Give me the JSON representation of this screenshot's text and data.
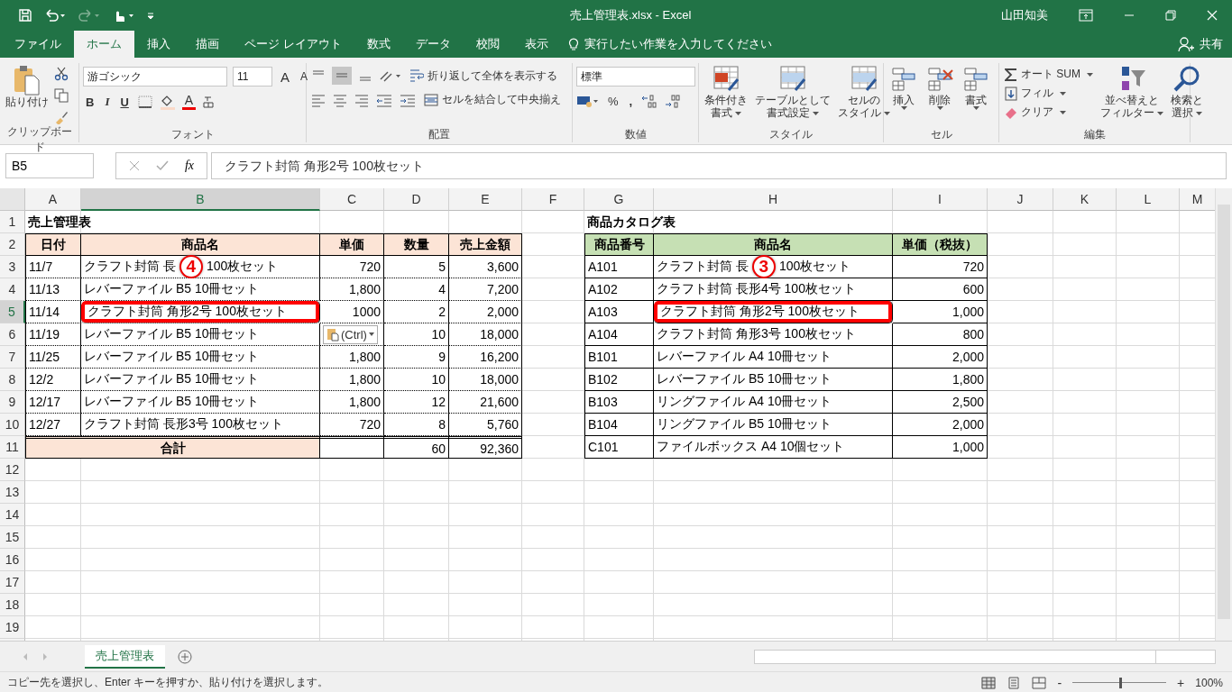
{
  "window": {
    "title": "売上管理表.xlsx  -  Excel",
    "user": "山田知美"
  },
  "tabs": [
    {
      "label": "ファイル",
      "selected": false
    },
    {
      "label": "ホーム",
      "selected": true
    },
    {
      "label": "挿入",
      "selected": false
    },
    {
      "label": "描画",
      "selected": false
    },
    {
      "label": "ページ レイアウト",
      "selected": false
    },
    {
      "label": "数式",
      "selected": false
    },
    {
      "label": "データ",
      "selected": false
    },
    {
      "label": "校閲",
      "selected": false
    },
    {
      "label": "表示",
      "selected": false
    }
  ],
  "tell_me": "実行したい作業を入力してください",
  "share": "共有",
  "ribbon": {
    "clipboard": {
      "label": "クリップボード",
      "paste": "貼り付け"
    },
    "font": {
      "label": "フォント",
      "family": "游ゴシック",
      "size": "11",
      "grow": "A",
      "shrink": "A",
      "bold": "B",
      "italic": "I",
      "underline": "U",
      "font_color": "A"
    },
    "alignment": {
      "label": "配置",
      "wrap": "折り返して全体を表示する",
      "merge": "セルを結合して中央揃え"
    },
    "number": {
      "label": "数値",
      "format": "標準",
      "percent": "%",
      "comma": ","
    },
    "styles": {
      "label": "スタイル",
      "buttons": [
        [
          "条件付き",
          "書式"
        ],
        [
          "テーブルとして",
          "書式設定"
        ],
        [
          "セルの",
          "スタイル"
        ]
      ]
    },
    "cells": {
      "label": "セル",
      "buttons": [
        "挿入",
        "削除",
        "書式"
      ]
    },
    "editing": {
      "label": "編集",
      "autosum": "オート SUM",
      "fill": "フィル",
      "clear": "クリア",
      "buttons": [
        [
          "並べ替えと",
          "フィルター"
        ],
        [
          "検索と",
          "選択"
        ]
      ]
    }
  },
  "formula_bar": {
    "name_box": "B5",
    "fx": "fx",
    "content": "クラフト封筒 角形2号 100枚セット"
  },
  "sheet": {
    "columns": [
      {
        "label": "A",
        "selected": false
      },
      {
        "label": "B",
        "selected": true
      },
      {
        "label": "C",
        "selected": false
      },
      {
        "label": "D",
        "selected": false
      },
      {
        "label": "E",
        "selected": false
      },
      {
        "label": "F",
        "selected": false
      },
      {
        "label": "G",
        "selected": false
      },
      {
        "label": "H",
        "selected": false
      },
      {
        "label": "I",
        "selected": false
      },
      {
        "label": "J",
        "selected": false
      },
      {
        "label": "K",
        "selected": false
      },
      {
        "label": "L",
        "selected": false
      },
      {
        "label": "M",
        "selected": false
      }
    ],
    "rows": [
      {
        "label": "1",
        "selected": false
      },
      {
        "label": "2",
        "selected": false
      },
      {
        "label": "3",
        "selected": false
      },
      {
        "label": "4",
        "selected": false
      },
      {
        "label": "5",
        "selected": true
      },
      {
        "label": "6",
        "selected": false
      },
      {
        "label": "7",
        "selected": false
      },
      {
        "label": "8",
        "selected": false
      },
      {
        "label": "9",
        "selected": false
      },
      {
        "label": "10",
        "selected": false
      },
      {
        "label": "11",
        "selected": false
      },
      {
        "label": "12",
        "selected": false
      },
      {
        "label": "13",
        "selected": false
      },
      {
        "label": "14",
        "selected": false
      },
      {
        "label": "15",
        "selected": false
      },
      {
        "label": "16",
        "selected": false
      },
      {
        "label": "17",
        "selected": false
      },
      {
        "label": "18",
        "selected": false
      },
      {
        "label": "19",
        "selected": false
      }
    ]
  },
  "sales": {
    "title": "売上管理表",
    "headers": [
      "日付",
      "商品名",
      "単価",
      "数量",
      "売上金額"
    ],
    "rows": [
      {
        "date": "11/7",
        "name_before": "クラフト封筒 長",
        "marker": "4",
        "name_after": "100枚セット",
        "price": "720",
        "qty": "5",
        "amount": "3,600",
        "highlighted": false
      },
      {
        "date": "11/13",
        "name": "レバーファイル B5 10冊セット",
        "price": "1,800",
        "qty": "4",
        "amount": "7,200",
        "highlighted": false
      },
      {
        "date": "11/14",
        "name": "クラフト封筒 角形2号 100枚セット",
        "price": "1000",
        "qty": "2",
        "amount": "2,000",
        "highlighted": true
      },
      {
        "date": "11/19",
        "name": "レバーファイル B5 10冊セット",
        "paste_button": "(Ctrl)",
        "qty": "10",
        "amount": "18,000",
        "highlighted": false
      },
      {
        "date": "11/25",
        "name": "レバーファイル B5 10冊セット",
        "price": "1,800",
        "qty": "9",
        "amount": "16,200",
        "highlighted": false
      },
      {
        "date": "12/2",
        "name": "レバーファイル B5 10冊セット",
        "price": "1,800",
        "qty": "10",
        "amount": "18,000",
        "highlighted": false
      },
      {
        "date": "12/17",
        "name": "レバーファイル B5 10冊セット",
        "price": "1,800",
        "qty": "12",
        "amount": "21,600",
        "highlighted": false
      },
      {
        "date": "12/27",
        "name": "クラフト封筒 長形3号 100枚セット",
        "price": "720",
        "qty": "8",
        "amount": "5,760",
        "highlighted": false
      }
    ],
    "total": {
      "label": "合計",
      "qty": "60",
      "amount": "92,360"
    }
  },
  "catalog": {
    "title": "商品カタログ表",
    "headers": [
      "商品番号",
      "商品名",
      "単価（税抜）"
    ],
    "rows": [
      {
        "code": "A101",
        "name_before": "クラフト封筒 長",
        "marker": "3",
        "name_after": "100枚セット",
        "price": "720",
        "highlighted": false
      },
      {
        "code": "A102",
        "name": "クラフト封筒 長形4号 100枚セット",
        "price": "600",
        "highlighted": false
      },
      {
        "code": "A103",
        "name": "クラフト封筒 角形2号 100枚セット",
        "price": "1,000",
        "highlighted": true
      },
      {
        "code": "A104",
        "name": "クラフト封筒 角形3号 100枚セット",
        "price": "800",
        "highlighted": false
      },
      {
        "code": "B101",
        "name": "レバーファイル A4 10冊セット",
        "price": "2,000",
        "highlighted": false
      },
      {
        "code": "B102",
        "name": "レバーファイル B5 10冊セット",
        "price": "1,800",
        "highlighted": false
      },
      {
        "code": "B103",
        "name": "リングファイル A4 10冊セット",
        "price": "2,500",
        "highlighted": false
      },
      {
        "code": "B104",
        "name": "リングファイル B5 10冊セット",
        "price": "2,000",
        "highlighted": false
      },
      {
        "code": "C101",
        "name": "ファイルボックス A4 10個セット",
        "price": "1,000",
        "highlighted": false
      }
    ]
  },
  "sheet_tabs": [
    {
      "label": "売上管理表",
      "selected": true
    }
  ],
  "status_bar": {
    "message": "コピー先を選択し、Enter キーを押すか、貼り付けを選択します。",
    "minus": "-",
    "plus": "+",
    "zoom": {
      "level": 0.5
    },
    "zoom_text": "100%"
  }
}
